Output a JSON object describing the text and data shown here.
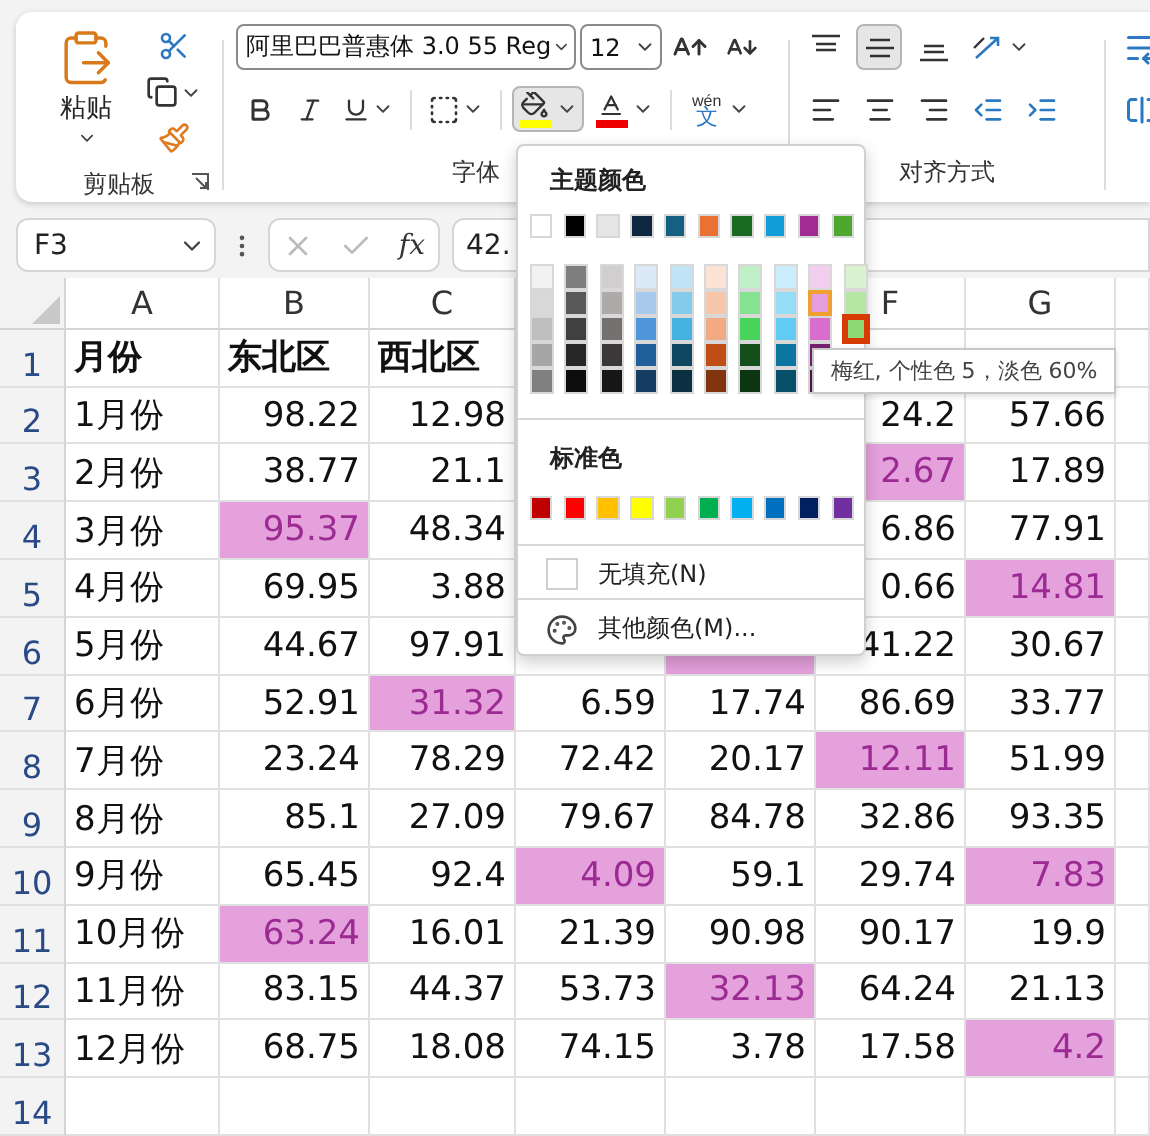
{
  "ribbon": {
    "clipboard": {
      "paste_label": "粘贴",
      "group_label": "剪贴板"
    },
    "font": {
      "font_name": "阿里巴巴普惠体 3.0 55 Reg",
      "font_size": "12",
      "fill_pressed": true,
      "phonetic_ruby": "wén",
      "phonetic_base": "文",
      "group_label": "字体"
    },
    "alignment": {
      "vertical": [
        {
          "kind": "top",
          "selected": false
        },
        {
          "kind": "middle",
          "selected": true
        },
        {
          "kind": "bottom",
          "selected": false
        },
        {
          "kind": "orientation",
          "selected": false
        }
      ],
      "horizontal": [
        {
          "kind": "left",
          "selected": false
        },
        {
          "kind": "center",
          "selected": false
        },
        {
          "kind": "right",
          "selected": false
        },
        {
          "kind": "indent-decrease",
          "selected": false
        },
        {
          "kind": "indent-increase",
          "selected": false
        }
      ],
      "group_label": "对齐方式"
    }
  },
  "formula_bar": {
    "name_box": "F3",
    "fx": "fx",
    "formula": "42."
  },
  "sheet": {
    "columns": [
      {
        "label": "A"
      },
      {
        "label": "B"
      },
      {
        "label": "C"
      },
      {},
      {},
      {
        "label": "F"
      },
      {
        "label": "G"
      }
    ],
    "rows": [
      {
        "header": "1",
        "bold": true,
        "cells": [
          {
            "text": "月份",
            "highlighted": false
          },
          {
            "text": "东北区",
            "highlighted": false
          },
          {
            "text": "西北区",
            "highlighted": false
          },
          {},
          {},
          {},
          {}
        ]
      },
      {
        "header": "2",
        "bold": false,
        "cells": [
          {
            "text": "1月份",
            "highlighted": false
          },
          {
            "text": "98.22",
            "highlighted": false
          },
          {
            "text": "12.98",
            "highlighted": false
          },
          {},
          {},
          {
            "text": "24.2",
            "highlighted": false
          },
          {
            "text": "57.66",
            "highlighted": false
          }
        ]
      },
      {
        "header": "3",
        "bold": false,
        "cells": [
          {
            "text": "2月份",
            "highlighted": false
          },
          {
            "text": "38.77",
            "highlighted": false
          },
          {
            "text": "21.1",
            "highlighted": false
          },
          {},
          {},
          {
            "text": "2.67",
            "highlighted": true
          },
          {
            "text": "17.89",
            "highlighted": false
          }
        ]
      },
      {
        "header": "4",
        "bold": false,
        "cells": [
          {
            "text": "3月份",
            "highlighted": false
          },
          {
            "text": "95.37",
            "highlighted": true
          },
          {
            "text": "48.34",
            "highlighted": false
          },
          {},
          {},
          {
            "text": "6.86",
            "highlighted": false
          },
          {
            "text": "77.91",
            "highlighted": false
          }
        ]
      },
      {
        "header": "5",
        "bold": false,
        "cells": [
          {
            "text": "4月份",
            "highlighted": false
          },
          {
            "text": "69.95",
            "highlighted": false
          },
          {
            "text": "3.88",
            "highlighted": false
          },
          {},
          {},
          {
            "text": "0.66",
            "highlighted": false
          },
          {
            "text": "14.81",
            "highlighted": true
          }
        ]
      },
      {
        "header": "6",
        "bold": false,
        "cells": [
          {
            "text": "5月份",
            "highlighted": false
          },
          {
            "text": "44.67",
            "highlighted": false
          },
          {
            "text": "97.91",
            "highlighted": false
          },
          {
            "highlighted": false
          },
          {
            "highlighted": true
          },
          {
            "text": "41.22",
            "highlighted": false
          },
          {
            "text": "30.67",
            "highlighted": false
          }
        ]
      },
      {
        "header": "7",
        "bold": false,
        "cells": [
          {
            "text": "6月份",
            "highlighted": false
          },
          {
            "text": "52.91",
            "highlighted": false
          },
          {
            "text": "31.32",
            "highlighted": true
          },
          {
            "text": "6.59",
            "highlighted": false
          },
          {
            "text": "17.74",
            "highlighted": false
          },
          {
            "text": "86.69",
            "highlighted": false
          },
          {
            "text": "33.77",
            "highlighted": false
          }
        ]
      },
      {
        "header": "8",
        "bold": false,
        "cells": [
          {
            "text": "7月份",
            "highlighted": false
          },
          {
            "text": "23.24",
            "highlighted": false
          },
          {
            "text": "78.29",
            "highlighted": false
          },
          {
            "text": "72.42",
            "highlighted": false
          },
          {
            "text": "20.17",
            "highlighted": false
          },
          {
            "text": "12.11",
            "highlighted": true
          },
          {
            "text": "51.99",
            "highlighted": false
          }
        ]
      },
      {
        "header": "9",
        "bold": false,
        "cells": [
          {
            "text": "8月份",
            "highlighted": false
          },
          {
            "text": "85.1",
            "highlighted": false
          },
          {
            "text": "27.09",
            "highlighted": false
          },
          {
            "text": "79.67",
            "highlighted": false
          },
          {
            "text": "84.78",
            "highlighted": false
          },
          {
            "text": "32.86",
            "highlighted": false
          },
          {
            "text": "93.35",
            "highlighted": false
          }
        ]
      },
      {
        "header": "10",
        "bold": false,
        "cells": [
          {
            "text": "9月份",
            "highlighted": false
          },
          {
            "text": "65.45",
            "highlighted": false
          },
          {
            "text": "92.4",
            "highlighted": false
          },
          {
            "text": "4.09",
            "highlighted": true
          },
          {
            "text": "59.1",
            "highlighted": false
          },
          {
            "text": "29.74",
            "highlighted": false
          },
          {
            "text": "7.83",
            "highlighted": true
          }
        ]
      },
      {
        "header": "11",
        "bold": false,
        "cells": [
          {
            "text": "10月份",
            "highlighted": false
          },
          {
            "text": "63.24",
            "highlighted": true
          },
          {
            "text": "16.01",
            "highlighted": false
          },
          {
            "text": "21.39",
            "highlighted": false
          },
          {
            "text": "90.98",
            "highlighted": false
          },
          {
            "text": "90.17",
            "highlighted": false
          },
          {
            "text": "19.9",
            "highlighted": false
          }
        ]
      },
      {
        "header": "12",
        "bold": false,
        "cells": [
          {
            "text": "11月份",
            "highlighted": false
          },
          {
            "text": "83.15",
            "highlighted": false
          },
          {
            "text": "44.37",
            "highlighted": false
          },
          {
            "text": "53.73",
            "highlighted": false
          },
          {
            "text": "32.13",
            "highlighted": true
          },
          {
            "text": "64.24",
            "highlighted": false
          },
          {
            "text": "21.13",
            "highlighted": false
          }
        ]
      },
      {
        "header": "13",
        "bold": false,
        "cells": [
          {
            "text": "12月份",
            "highlighted": false
          },
          {
            "text": "68.75",
            "highlighted": false
          },
          {
            "text": "18.08",
            "highlighted": false
          },
          {
            "text": "74.15",
            "highlighted": false
          },
          {
            "text": "3.78",
            "highlighted": false
          },
          {
            "text": "17.58",
            "highlighted": false
          },
          {
            "text": "4.2",
            "highlighted": true
          }
        ]
      },
      {
        "header": "14"
      }
    ]
  },
  "fill_menu": {
    "theme_title": "主题颜色",
    "theme_colors": [
      {
        "color": "#ffffff",
        "selected": false
      },
      {
        "color": "#000000",
        "selected": false
      },
      {
        "color": "#e7e6e6",
        "selected": false
      },
      {
        "color": "#0e2841",
        "selected": false
      },
      {
        "color": "#156082",
        "selected": false
      },
      {
        "color": "#e97132",
        "selected": false
      },
      {
        "color": "#196b24",
        "selected": false
      },
      {
        "color": "#0f9ed5",
        "selected": false
      },
      {
        "color": "#a02b93",
        "selected": false
      },
      {
        "color": "#4ea72e",
        "selected": false
      }
    ],
    "shade_columns": [
      {
        "swatches": [
          {
            "color": "#f2f2f2",
            "selected": false,
            "hovered": false
          },
          {
            "color": "#d9d9d9",
            "selected": false,
            "hovered": false
          },
          {
            "color": "#bfbfbf",
            "selected": false,
            "hovered": false
          },
          {
            "color": "#a6a6a6",
            "selected": false,
            "hovered": false
          },
          {
            "color": "#808080",
            "selected": false,
            "hovered": false
          }
        ]
      },
      {
        "swatches": [
          {
            "color": "#7f7f7f",
            "selected": false,
            "hovered": false
          },
          {
            "color": "#595959",
            "selected": false,
            "hovered": false
          },
          {
            "color": "#404040",
            "selected": false,
            "hovered": false
          },
          {
            "color": "#262626",
            "selected": false,
            "hovered": false
          },
          {
            "color": "#0d0d0d",
            "selected": false,
            "hovered": false
          }
        ]
      },
      {
        "swatches": [
          {
            "color": "#d0cece",
            "selected": false,
            "hovered": false
          },
          {
            "color": "#aeaaaa",
            "selected": false,
            "hovered": false
          },
          {
            "color": "#757171",
            "selected": false,
            "hovered": false
          },
          {
            "color": "#3a3838",
            "selected": false,
            "hovered": false
          },
          {
            "color": "#171616",
            "selected": false,
            "hovered": false
          }
        ]
      },
      {
        "swatches": [
          {
            "color": "#dceaf7",
            "selected": false,
            "hovered": false
          },
          {
            "color": "#a6c9ec",
            "selected": false,
            "hovered": false
          },
          {
            "color": "#4e95d9",
            "selected": false,
            "hovered": false
          },
          {
            "color": "#215f9a",
            "selected": false,
            "hovered": false
          },
          {
            "color": "#153d64",
            "selected": false,
            "hovered": false
          }
        ]
      },
      {
        "swatches": [
          {
            "color": "#c0e4f5",
            "selected": false,
            "hovered": false
          },
          {
            "color": "#83cbeb",
            "selected": false,
            "hovered": false
          },
          {
            "color": "#44b3e1",
            "selected": false,
            "hovered": false
          },
          {
            "color": "#0f4761",
            "selected": false,
            "hovered": false
          },
          {
            "color": "#0a3041",
            "selected": false,
            "hovered": false
          }
        ]
      },
      {
        "swatches": [
          {
            "color": "#fbe2d5",
            "selected": false,
            "hovered": false
          },
          {
            "color": "#f7c7ac",
            "selected": false,
            "hovered": false
          },
          {
            "color": "#f2aa84",
            "selected": false,
            "hovered": false
          },
          {
            "color": "#c04f15",
            "selected": false,
            "hovered": false
          },
          {
            "color": "#80350e",
            "selected": false,
            "hovered": false
          }
        ]
      },
      {
        "swatches": [
          {
            "color": "#c1f0c8",
            "selected": false,
            "hovered": false
          },
          {
            "color": "#84e291",
            "selected": false,
            "hovered": false
          },
          {
            "color": "#47d45a",
            "selected": false,
            "hovered": false
          },
          {
            "color": "#124f1a",
            "selected": false,
            "hovered": false
          },
          {
            "color": "#0c3512",
            "selected": false,
            "hovered": false
          }
        ]
      },
      {
        "swatches": [
          {
            "color": "#caedfb",
            "selected": false,
            "hovered": false
          },
          {
            "color": "#95dcf7",
            "selected": false,
            "hovered": false
          },
          {
            "color": "#61cbf3",
            "selected": false,
            "hovered": false
          },
          {
            "color": "#0b769f",
            "selected": false,
            "hovered": false
          },
          {
            "color": "#074f6a",
            "selected": false,
            "hovered": false
          }
        ]
      },
      {
        "swatches": [
          {
            "color": "#f2ceef",
            "selected": false,
            "hovered": false
          },
          {
            "color": "#e59edd",
            "selected": true,
            "hovered": false
          },
          {
            "color": "#d86dcd",
            "selected": false,
            "hovered": false
          },
          {
            "color": "#782070",
            "selected": false,
            "hovered": false
          },
          {
            "color": "#50164a",
            "selected": false,
            "hovered": false
          }
        ]
      },
      {
        "swatches": [
          {
            "color": "#daf2d0",
            "selected": false,
            "hovered": false
          },
          {
            "color": "#b5e6a2",
            "selected": false,
            "hovered": false
          },
          {
            "color": "#8ed973",
            "selected": false,
            "hovered": true
          }
        ]
      }
    ],
    "standard_title": "标准色",
    "standard_colors": [
      {
        "color": "#c00000",
        "selected": false
      },
      {
        "color": "#ff0000",
        "selected": false
      },
      {
        "color": "#ffc000",
        "selected": false
      },
      {
        "color": "#ffff00",
        "selected": false
      },
      {
        "color": "#92d050",
        "selected": false
      },
      {
        "color": "#00b050",
        "selected": false
      },
      {
        "color": "#00b0f0",
        "selected": false
      },
      {
        "color": "#0070c0",
        "selected": false
      },
      {
        "color": "#002060",
        "selected": false
      },
      {
        "color": "#7030a0",
        "selected": false
      }
    ],
    "no_fill": "无填充(N)",
    "more_colors": "其他颜色(M)..."
  },
  "tooltip": "梅红, 个性色 5，淡色 60%"
}
